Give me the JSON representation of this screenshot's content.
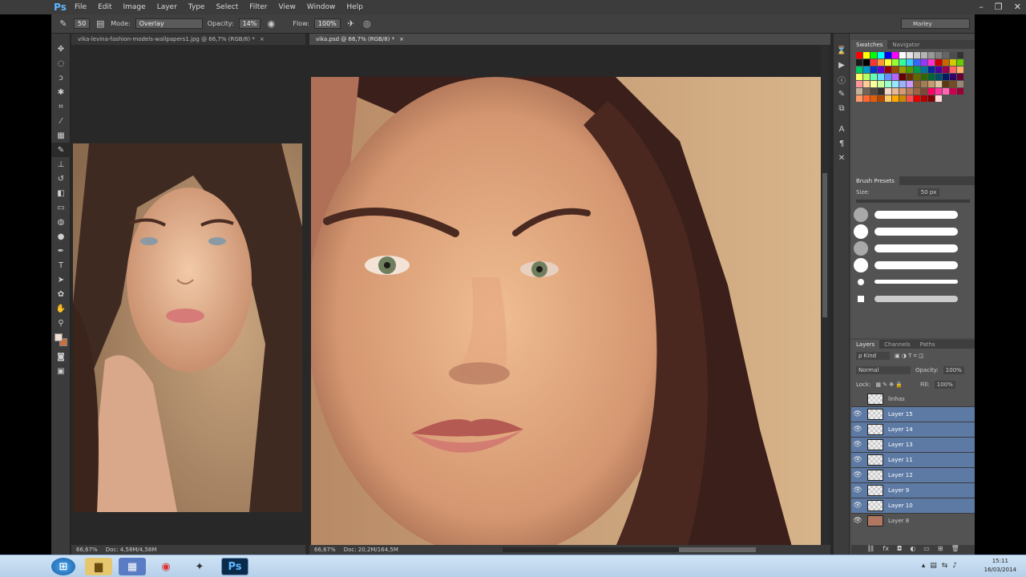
{
  "app": {
    "logo": "Ps"
  },
  "menu": [
    "File",
    "Edit",
    "Image",
    "Layer",
    "Type",
    "Select",
    "Filter",
    "View",
    "Window",
    "Help"
  ],
  "window_controls": {
    "minimize": "–",
    "restore": "❐",
    "close": "✕"
  },
  "options": {
    "brush_size": "50",
    "mode_label": "Mode:",
    "mode_value": "Overlay",
    "opacity_label": "Opacity:",
    "opacity_value": "14%",
    "flow_label": "Flow:",
    "flow_value": "100%",
    "workspace": "Marley"
  },
  "documents": [
    {
      "title": "vika-levina-fashion-models-wallpapers1.jpg @ 66,7% (RGB/8) *",
      "zoom": "66,67%",
      "doc_info": "Doc: 4,58M/4,58M"
    },
    {
      "title": "vika.psd @ 66,7% (RGB/8) *",
      "zoom": "66,67%",
      "doc_info": "Doc: 20,2M/164,5M"
    }
  ],
  "swatches_panel": {
    "tabs": [
      "Swatches",
      "Navigator"
    ],
    "colors": [
      "#ff0000",
      "#ffff00",
      "#00ff00",
      "#00ffff",
      "#0000ff",
      "#ff00ff",
      "#ffffff",
      "#e6e6e6",
      "#cccccc",
      "#b3b3b3",
      "#999999",
      "#808080",
      "#666666",
      "#4d4d4d",
      "#333333",
      "#1a1a1a",
      "#000000",
      "#ff3333",
      "#ff9933",
      "#ffff33",
      "#99ff33",
      "#33ff99",
      "#33ccff",
      "#3366ff",
      "#9933ff",
      "#ff33cc",
      "#cc0000",
      "#cc6600",
      "#cccc00",
      "#66cc00",
      "#00cc66",
      "#0099cc",
      "#0033cc",
      "#6600cc",
      "#990000",
      "#994c00",
      "#999900",
      "#4d9900",
      "#00994d",
      "#007399",
      "#002699",
      "#4d0099",
      "#99004d",
      "#ff6666",
      "#ffb366",
      "#ffff66",
      "#b3ff66",
      "#66ffb3",
      "#66d9ff",
      "#668cff",
      "#b366ff",
      "#660000",
      "#663300",
      "#666600",
      "#336600",
      "#006633",
      "#004d66",
      "#001a66",
      "#330066",
      "#660033",
      "#ff9999",
      "#ffcc99",
      "#ffff99",
      "#ccff99",
      "#99ffcc",
      "#99e6ff",
      "#99b3ff",
      "#cc99ff",
      "#8c6239",
      "#a67c52",
      "#c69c6d",
      "#e0c3a0",
      "#603913",
      "#754c24",
      "#998675",
      "#c7b299",
      "#736357",
      "#534741",
      "#362f2d",
      "#f7d7c4",
      "#e8b796",
      "#d49a75",
      "#b87c5a",
      "#9c6244",
      "#7f4a32",
      "#ff0066",
      "#ff3399",
      "#ff66b3",
      "#cc0052",
      "#990033",
      "#ff9966",
      "#ff6633",
      "#e65c00",
      "#b34700",
      "#ffcc66",
      "#ffaa00",
      "#cc8800",
      "#ff4d4d",
      "#e60000",
      "#b30000",
      "#800000",
      "#ffd9d9"
    ]
  },
  "brush_presets": {
    "title": "Brush Presets",
    "size_label": "Size:",
    "size_value": "50 px"
  },
  "layers_panel": {
    "tabs": [
      "Layers",
      "Channels",
      "Paths"
    ],
    "kind_label": "ρ Kind",
    "blend_mode": "Normal",
    "opacity_label": "Opacity:",
    "opacity_value": "100%",
    "lock_label": "Lock:",
    "fill_label": "Fill:",
    "fill_value": "100%",
    "layers": [
      {
        "name": "linhas",
        "visible": false,
        "selected": false,
        "thumb": "blank"
      },
      {
        "name": "Layer 15",
        "visible": true,
        "selected": true,
        "thumb": "blank"
      },
      {
        "name": "Layer 14",
        "visible": true,
        "selected": true,
        "thumb": "blank"
      },
      {
        "name": "Layer 13",
        "visible": true,
        "selected": true,
        "thumb": "blank"
      },
      {
        "name": "Layer 11",
        "visible": true,
        "selected": true,
        "thumb": "blank"
      },
      {
        "name": "Layer 12",
        "visible": true,
        "selected": true,
        "thumb": "blank"
      },
      {
        "name": "Layer 9",
        "visible": true,
        "selected": true,
        "thumb": "blank"
      },
      {
        "name": "Layer 10",
        "visible": true,
        "selected": true,
        "thumb": "blank"
      },
      {
        "name": "Layer 8",
        "visible": true,
        "selected": false,
        "thumb": "image"
      }
    ]
  },
  "taskbar": {
    "time": "15:11",
    "date": "16/03/2014"
  },
  "colors": {
    "selection": "#5d7aa5",
    "skin": "#d9a27f",
    "hair": "#3a2018",
    "background": "#c8a278"
  }
}
